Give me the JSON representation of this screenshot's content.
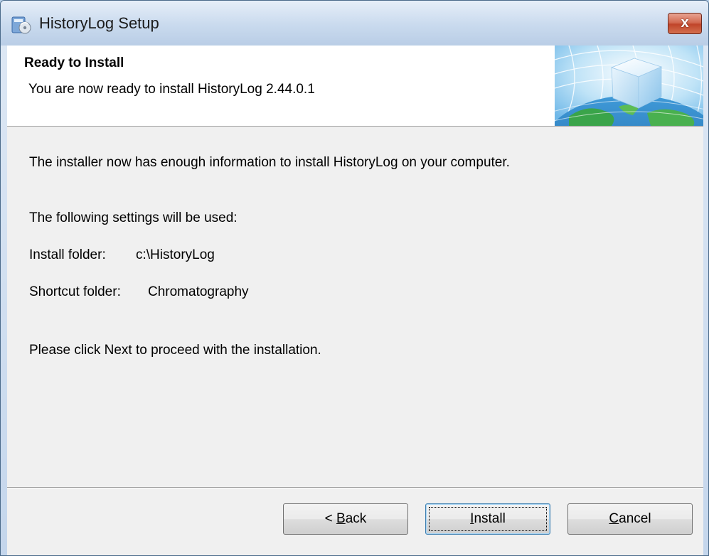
{
  "window": {
    "title": "HistoryLog Setup",
    "close_label": "x"
  },
  "banner": {
    "title": "Ready to Install",
    "subtitle": "You are now ready to install HistoryLog 2.44.0.1"
  },
  "content": {
    "intro": "The installer now has enough information to install HistoryLog on your computer.",
    "settings_heading": "The following settings will be used:",
    "install_folder_label": "Install folder:",
    "install_folder_value": "c:\\HistoryLog",
    "shortcut_folder_label": "Shortcut folder:",
    "shortcut_folder_value": "Chromatography",
    "proceed_text": "Please click Next to proceed with the installation."
  },
  "buttons": {
    "back": {
      "prefix": "< ",
      "mnemonic": "B",
      "rest": "ack"
    },
    "install": {
      "prefix": "",
      "mnemonic": "I",
      "rest": "nstall"
    },
    "cancel": {
      "prefix": "",
      "mnemonic": "C",
      "rest": "ancel"
    }
  },
  "icons": {
    "app": "installer-disc-icon",
    "banner": "cube-globe-graphic"
  },
  "colors": {
    "title_bar": "#c9daee",
    "close_button": "#c0452a",
    "dialog_background": "#f0f0f0",
    "banner_background": "#ffffff",
    "default_button_border": "#3c7fb1"
  }
}
